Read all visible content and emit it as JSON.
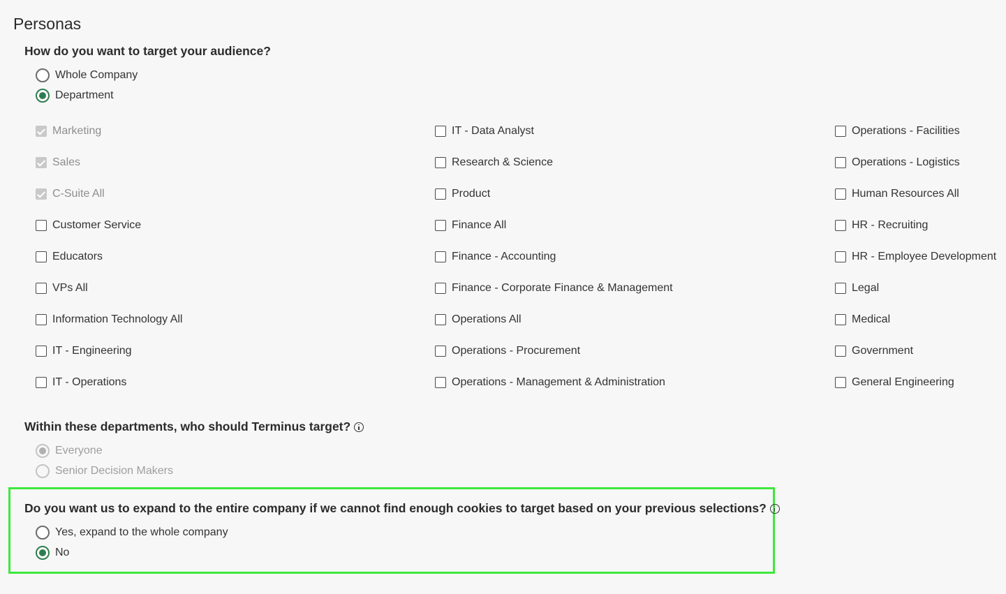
{
  "page_title": "Personas",
  "targeting": {
    "question": "How do you want to target your audience?",
    "options": [
      {
        "label": "Whole Company",
        "selected": false
      },
      {
        "label": "Department",
        "selected": true
      }
    ]
  },
  "departments": {
    "columns": [
      [
        {
          "label": "Marketing",
          "checked": true,
          "disabled": true
        },
        {
          "label": "Sales",
          "checked": true,
          "disabled": true
        },
        {
          "label": "C-Suite All",
          "checked": true,
          "disabled": true
        },
        {
          "label": "Customer Service",
          "checked": false,
          "disabled": false
        },
        {
          "label": "Educators",
          "checked": false,
          "disabled": false
        },
        {
          "label": "VPs All",
          "checked": false,
          "disabled": false
        },
        {
          "label": "Information Technology All",
          "checked": false,
          "disabled": false
        },
        {
          "label": "IT - Engineering",
          "checked": false,
          "disabled": false
        },
        {
          "label": "IT - Operations",
          "checked": false,
          "disabled": false
        }
      ],
      [
        {
          "label": "IT - Data Analyst",
          "checked": false,
          "disabled": false
        },
        {
          "label": "Research & Science",
          "checked": false,
          "disabled": false
        },
        {
          "label": "Product",
          "checked": false,
          "disabled": false
        },
        {
          "label": "Finance All",
          "checked": false,
          "disabled": false
        },
        {
          "label": "Finance - Accounting",
          "checked": false,
          "disabled": false
        },
        {
          "label": "Finance - Corporate Finance & Management",
          "checked": false,
          "disabled": false
        },
        {
          "label": "Operations All",
          "checked": false,
          "disabled": false
        },
        {
          "label": "Operations - Procurement",
          "checked": false,
          "disabled": false
        },
        {
          "label": "Operations - Management & Administration",
          "checked": false,
          "disabled": false
        }
      ],
      [
        {
          "label": "Operations - Facilities",
          "checked": false,
          "disabled": false
        },
        {
          "label": "Operations - Logistics",
          "checked": false,
          "disabled": false
        },
        {
          "label": "Human Resources All",
          "checked": false,
          "disabled": false
        },
        {
          "label": "HR - Recruiting",
          "checked": false,
          "disabled": false
        },
        {
          "label": "HR - Employee Development",
          "checked": false,
          "disabled": false
        },
        {
          "label": "Legal",
          "checked": false,
          "disabled": false
        },
        {
          "label": "Medical",
          "checked": false,
          "disabled": false
        },
        {
          "label": "Government",
          "checked": false,
          "disabled": false
        },
        {
          "label": "General Engineering",
          "checked": false,
          "disabled": false
        }
      ]
    ]
  },
  "seniority": {
    "question": "Within these departments, who should Terminus target?",
    "options": [
      {
        "label": "Everyone",
        "selected": true,
        "disabled": true
      },
      {
        "label": "Senior Decision Makers",
        "selected": false,
        "disabled": true
      }
    ]
  },
  "expand": {
    "question": "Do you want us to expand to the entire company if we cannot find enough cookies to target based on your previous selections?",
    "options": [
      {
        "label": "Yes, expand to the whole company",
        "selected": false
      },
      {
        "label": "No",
        "selected": true
      }
    ],
    "highlight_color": "#3ee83b"
  },
  "colors": {
    "accent": "#2e7d4f",
    "background": "#f7f7f7"
  }
}
